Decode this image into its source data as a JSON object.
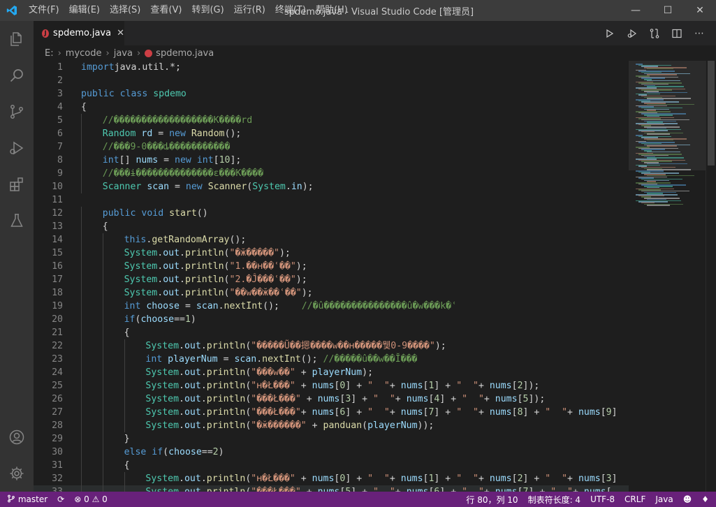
{
  "window": {
    "title": "spdemo.java - Visual Studio Code [管理员]",
    "menu": [
      "文件(F)",
      "编辑(E)",
      "选择(S)",
      "查看(V)",
      "转到(G)",
      "运行(R)",
      "终端(T)",
      "帮助(H)"
    ]
  },
  "tab": {
    "label": "spdemo.java",
    "close": "✕"
  },
  "breadcrumb": [
    "E:",
    "mycode",
    "java",
    "spdemo.java"
  ],
  "colors": {
    "statusbar": "#68217a",
    "keyword": "#569cd6",
    "type": "#4ec9b0",
    "string": "#ce9178",
    "comment": "#6a9955"
  },
  "code_lines": [
    {
      "n": "1",
      "indent": 0,
      "t": [
        [
          "kw",
          "import"
        ],
        [
          "",
          "java.util.*;"
        ]
      ]
    },
    {
      "n": "2",
      "indent": 0,
      "t": []
    },
    {
      "n": "3",
      "indent": 0,
      "t": [
        [
          "kw",
          "public class "
        ],
        [
          "ty",
          "spdemo"
        ]
      ]
    },
    {
      "n": "4",
      "indent": 0,
      "t": [
        [
          "",
          "{"
        ]
      ]
    },
    {
      "n": "5",
      "indent": 1,
      "t": [
        [
          "cm",
          "//������������������K����rd"
        ]
      ]
    },
    {
      "n": "6",
      "indent": 1,
      "t": [
        [
          "ty",
          "Random "
        ],
        [
          "vr",
          "rd"
        ],
        [
          "",
          " = "
        ],
        [
          "kw",
          "new "
        ],
        [
          "fn",
          "Random"
        ],
        [
          "",
          "();"
        ]
      ]
    },
    {
      "n": "7",
      "indent": 1,
      "t": [
        [
          "cm",
          "//���9-0���ȡ�����������"
        ]
      ]
    },
    {
      "n": "8",
      "indent": 1,
      "t": [
        [
          "kw",
          "int"
        ],
        [
          "",
          "[] "
        ],
        [
          "vr",
          "nums"
        ],
        [
          "",
          " = "
        ],
        [
          "kw",
          "new "
        ],
        [
          "kw",
          "int"
        ],
        [
          "",
          "["
        ],
        [
          "nm",
          "10"
        ],
        [
          "",
          "];"
        ]
      ]
    },
    {
      "n": "9",
      "indent": 1,
      "t": [
        [
          "cm",
          "//���ɨ��������������ɛ���K����"
        ]
      ]
    },
    {
      "n": "10",
      "indent": 1,
      "t": [
        [
          "ty",
          "Scanner "
        ],
        [
          "vr",
          "scan"
        ],
        [
          "",
          " = "
        ],
        [
          "kw",
          "new "
        ],
        [
          "fn",
          "Scanner"
        ],
        [
          "",
          "("
        ],
        [
          "ty",
          "System"
        ],
        [
          "",
          "."
        ],
        [
          "vr",
          "in"
        ],
        [
          "",
          ");"
        ]
      ]
    },
    {
      "n": "11",
      "indent": 0,
      "t": []
    },
    {
      "n": "12",
      "indent": 1,
      "t": [
        [
          "kw",
          "public void "
        ],
        [
          "fn",
          "start"
        ],
        [
          "",
          "()"
        ]
      ]
    },
    {
      "n": "13",
      "indent": 1,
      "t": [
        [
          "",
          "{"
        ]
      ]
    },
    {
      "n": "14",
      "indent": 2,
      "t": [
        [
          "kw",
          "this"
        ],
        [
          "",
          "."
        ],
        [
          "fn",
          "getRandomArray"
        ],
        [
          "",
          "();"
        ]
      ]
    },
    {
      "n": "15",
      "indent": 2,
      "t": [
        [
          "ty",
          "System"
        ],
        [
          "",
          "."
        ],
        [
          "vr",
          "out"
        ],
        [
          "",
          "."
        ],
        [
          "fn",
          "println"
        ],
        [
          "",
          "("
        ],
        [
          "st",
          "\"�ӂ�����\""
        ],
        [
          "",
          ");"
        ]
      ]
    },
    {
      "n": "16",
      "indent": 2,
      "t": [
        [
          "ty",
          "System"
        ],
        [
          "",
          "."
        ],
        [
          "vr",
          "out"
        ],
        [
          "",
          "."
        ],
        [
          "fn",
          "println"
        ],
        [
          "",
          "("
        ],
        [
          "st",
          "\"1.��ʜ��ʿ��\""
        ],
        [
          "",
          ");"
        ]
      ]
    },
    {
      "n": "17",
      "indent": 2,
      "t": [
        [
          "ty",
          "System"
        ],
        [
          "",
          "."
        ],
        [
          "vr",
          "out"
        ],
        [
          "",
          "."
        ],
        [
          "fn",
          "println"
        ],
        [
          "",
          "("
        ],
        [
          "st",
          "\"2.�Ĵ���ʿ��\""
        ],
        [
          "",
          ");"
        ]
      ]
    },
    {
      "n": "18",
      "indent": 2,
      "t": [
        [
          "ty",
          "System"
        ],
        [
          "",
          "."
        ],
        [
          "vr",
          "out"
        ],
        [
          "",
          "."
        ],
        [
          "fn",
          "println"
        ],
        [
          "",
          "("
        ],
        [
          "st",
          "\"��w��ӂ��ʿ��\""
        ],
        [
          "",
          ");"
        ]
      ]
    },
    {
      "n": "19",
      "indent": 2,
      "t": [
        [
          "kw",
          "int "
        ],
        [
          "vr",
          "choose"
        ],
        [
          "",
          " = "
        ],
        [
          "vr",
          "scan"
        ],
        [
          "",
          "."
        ],
        [
          "fn",
          "nextInt"
        ],
        [
          "",
          "();    "
        ],
        [
          "cm",
          "//�û���������������û�w���k�ʿ"
        ]
      ]
    },
    {
      "n": "20",
      "indent": 2,
      "t": [
        [
          "kw",
          "if"
        ],
        [
          "",
          "("
        ],
        [
          "vr",
          "choose"
        ],
        [
          "",
          "=="
        ],
        [
          "nm",
          "1"
        ],
        [
          "",
          ")"
        ]
      ]
    },
    {
      "n": "21",
      "indent": 2,
      "t": [
        [
          "",
          "{"
        ]
      ]
    },
    {
      "n": "22",
      "indent": 3,
      "t": [
        [
          "ty",
          "System"
        ],
        [
          "",
          "."
        ],
        [
          "vr",
          "out"
        ],
        [
          "",
          "."
        ],
        [
          "fn",
          "println"
        ],
        [
          "",
          "("
        ],
        [
          "st",
          "\"�����Ũ��摁����w��ʜ�����뮃0-9����\""
        ],
        [
          "",
          ");"
        ]
      ]
    },
    {
      "n": "23",
      "indent": 3,
      "t": [
        [
          "kw",
          "int "
        ],
        [
          "vr",
          "playerNum"
        ],
        [
          "",
          " = "
        ],
        [
          "vr",
          "scan"
        ],
        [
          "",
          "."
        ],
        [
          "fn",
          "nextInt"
        ],
        [
          "",
          "(); "
        ],
        [
          "cm",
          "//�����û��w��Ĭ���"
        ]
      ]
    },
    {
      "n": "24",
      "indent": 3,
      "t": [
        [
          "ty",
          "System"
        ],
        [
          "",
          "."
        ],
        [
          "vr",
          "out"
        ],
        [
          "",
          "."
        ],
        [
          "fn",
          "println"
        ],
        [
          "",
          "("
        ],
        [
          "st",
          "\"���w��\""
        ],
        [
          "",
          " + "
        ],
        [
          "vr",
          "playerNum"
        ],
        [
          "",
          ");"
        ]
      ]
    },
    {
      "n": "25",
      "indent": 3,
      "t": [
        [
          "ty",
          "System"
        ],
        [
          "",
          "."
        ],
        [
          "vr",
          "out"
        ],
        [
          "",
          "."
        ],
        [
          "fn",
          "println"
        ],
        [
          "",
          "("
        ],
        [
          "st",
          "\"ʜ�Ł���\""
        ],
        [
          "",
          " + "
        ],
        [
          "vr",
          "nums"
        ],
        [
          "",
          "["
        ],
        [
          "nm",
          "0"
        ],
        [
          "",
          "] + "
        ],
        [
          "st",
          "\"  \""
        ],
        [
          "",
          "+ "
        ],
        [
          "vr",
          "nums"
        ],
        [
          "",
          "["
        ],
        [
          "nm",
          "1"
        ],
        [
          "",
          "] + "
        ],
        [
          "st",
          "\"  \""
        ],
        [
          "",
          "+ "
        ],
        [
          "vr",
          "nums"
        ],
        [
          "",
          "["
        ],
        [
          "nm",
          "2"
        ],
        [
          "",
          "]);"
        ]
      ]
    },
    {
      "n": "26",
      "indent": 3,
      "t": [
        [
          "ty",
          "System"
        ],
        [
          "",
          "."
        ],
        [
          "vr",
          "out"
        ],
        [
          "",
          "."
        ],
        [
          "fn",
          "println"
        ],
        [
          "",
          "("
        ],
        [
          "st",
          "\"���Ł���\""
        ],
        [
          "",
          " + "
        ],
        [
          "vr",
          "nums"
        ],
        [
          "",
          "["
        ],
        [
          "nm",
          "3"
        ],
        [
          "",
          "] + "
        ],
        [
          "st",
          "\"  \""
        ],
        [
          "",
          "+ "
        ],
        [
          "vr",
          "nums"
        ],
        [
          "",
          "["
        ],
        [
          "nm",
          "4"
        ],
        [
          "",
          "] + "
        ],
        [
          "st",
          "\"  \""
        ],
        [
          "",
          "+ "
        ],
        [
          "vr",
          "nums"
        ],
        [
          "",
          "["
        ],
        [
          "nm",
          "5"
        ],
        [
          "",
          "]);"
        ]
      ]
    },
    {
      "n": "27",
      "indent": 3,
      "t": [
        [
          "ty",
          "System"
        ],
        [
          "",
          "."
        ],
        [
          "vr",
          "out"
        ],
        [
          "",
          "."
        ],
        [
          "fn",
          "println"
        ],
        [
          "",
          "("
        ],
        [
          "st",
          "\"���Ł���\""
        ],
        [
          "",
          "+ "
        ],
        [
          "vr",
          "nums"
        ],
        [
          "",
          "["
        ],
        [
          "nm",
          "6"
        ],
        [
          "",
          "] + "
        ],
        [
          "st",
          "\"  \""
        ],
        [
          "",
          "+ "
        ],
        [
          "vr",
          "nums"
        ],
        [
          "",
          "["
        ],
        [
          "nm",
          "7"
        ],
        [
          "",
          "] + "
        ],
        [
          "st",
          "\"  \""
        ],
        [
          "",
          "+ "
        ],
        [
          "vr",
          "nums"
        ],
        [
          "",
          "["
        ],
        [
          "nm",
          "8"
        ],
        [
          "",
          "] + "
        ],
        [
          "st",
          "\"  \""
        ],
        [
          "",
          "+ "
        ],
        [
          "vr",
          "nums"
        ],
        [
          "",
          "["
        ],
        [
          "nm",
          "9"
        ],
        [
          "",
          "]"
        ]
      ]
    },
    {
      "n": "28",
      "indent": 3,
      "t": [
        [
          "ty",
          "System"
        ],
        [
          "",
          "."
        ],
        [
          "vr",
          "out"
        ],
        [
          "",
          "."
        ],
        [
          "fn",
          "println"
        ],
        [
          "",
          "("
        ],
        [
          "st",
          "\"�ӂ������\""
        ],
        [
          "",
          " + "
        ],
        [
          "fn",
          "panduan"
        ],
        [
          "",
          "("
        ],
        [
          "vr",
          "playerNum"
        ],
        [
          "",
          "));"
        ]
      ]
    },
    {
      "n": "29",
      "indent": 2,
      "t": [
        [
          "",
          "}"
        ]
      ]
    },
    {
      "n": "30",
      "indent": 2,
      "t": [
        [
          "kw",
          "else if"
        ],
        [
          "",
          "("
        ],
        [
          "vr",
          "choose"
        ],
        [
          "",
          "=="
        ],
        [
          "nm",
          "2"
        ],
        [
          "",
          ")"
        ]
      ]
    },
    {
      "n": "31",
      "indent": 2,
      "t": [
        [
          "",
          "{"
        ]
      ]
    },
    {
      "n": "32",
      "indent": 3,
      "t": [
        [
          "ty",
          "System"
        ],
        [
          "",
          "."
        ],
        [
          "vr",
          "out"
        ],
        [
          "",
          "."
        ],
        [
          "fn",
          "println"
        ],
        [
          "",
          "("
        ],
        [
          "st",
          "\"ʜ�Ł���\""
        ],
        [
          "",
          " + "
        ],
        [
          "vr",
          "nums"
        ],
        [
          "",
          "["
        ],
        [
          "nm",
          "0"
        ],
        [
          "",
          "] + "
        ],
        [
          "st",
          "\"  \""
        ],
        [
          "",
          "+ "
        ],
        [
          "vr",
          "nums"
        ],
        [
          "",
          "["
        ],
        [
          "nm",
          "1"
        ],
        [
          "",
          "] + "
        ],
        [
          "st",
          "\"  \""
        ],
        [
          "",
          "+ "
        ],
        [
          "vr",
          "nums"
        ],
        [
          "",
          "["
        ],
        [
          "nm",
          "2"
        ],
        [
          "",
          "] + "
        ],
        [
          "st",
          "\"  \""
        ],
        [
          "",
          "+ "
        ],
        [
          "vr",
          "nums"
        ],
        [
          "",
          "["
        ],
        [
          "nm",
          "3"
        ],
        [
          "",
          "]"
        ]
      ]
    },
    {
      "n": "33",
      "indent": 3,
      "t": [
        [
          "ty",
          "System"
        ],
        [
          "",
          "."
        ],
        [
          "vr",
          "out"
        ],
        [
          "",
          "."
        ],
        [
          "fn",
          "println"
        ],
        [
          "",
          "("
        ],
        [
          "st",
          "\"���Ł���\""
        ],
        [
          "",
          " + "
        ],
        [
          "vr",
          "nums"
        ],
        [
          "",
          "["
        ],
        [
          "nm",
          "5"
        ],
        [
          "",
          "] + "
        ],
        [
          "st",
          "\"  \""
        ],
        [
          "",
          "+ "
        ],
        [
          "vr",
          "nums"
        ],
        [
          "",
          "["
        ],
        [
          "nm",
          "6"
        ],
        [
          "",
          "] + "
        ],
        [
          "st",
          "\"  \""
        ],
        [
          "",
          "+ "
        ],
        [
          "vr",
          "nums"
        ],
        [
          "",
          "["
        ],
        [
          "nm",
          "7"
        ],
        [
          "",
          "] + "
        ],
        [
          "st",
          "\"  \""
        ],
        [
          "",
          "+ "
        ],
        [
          "vr",
          "nums"
        ],
        [
          "",
          "["
        ]
      ]
    }
  ],
  "statusbar": {
    "branch": "master",
    "errors": "0",
    "warnings": "0",
    "position": "行 80，列 10",
    "tabsize": "制表符长度: 4",
    "encoding": "UTF-8",
    "eol": "CRLF",
    "language": "Java"
  }
}
